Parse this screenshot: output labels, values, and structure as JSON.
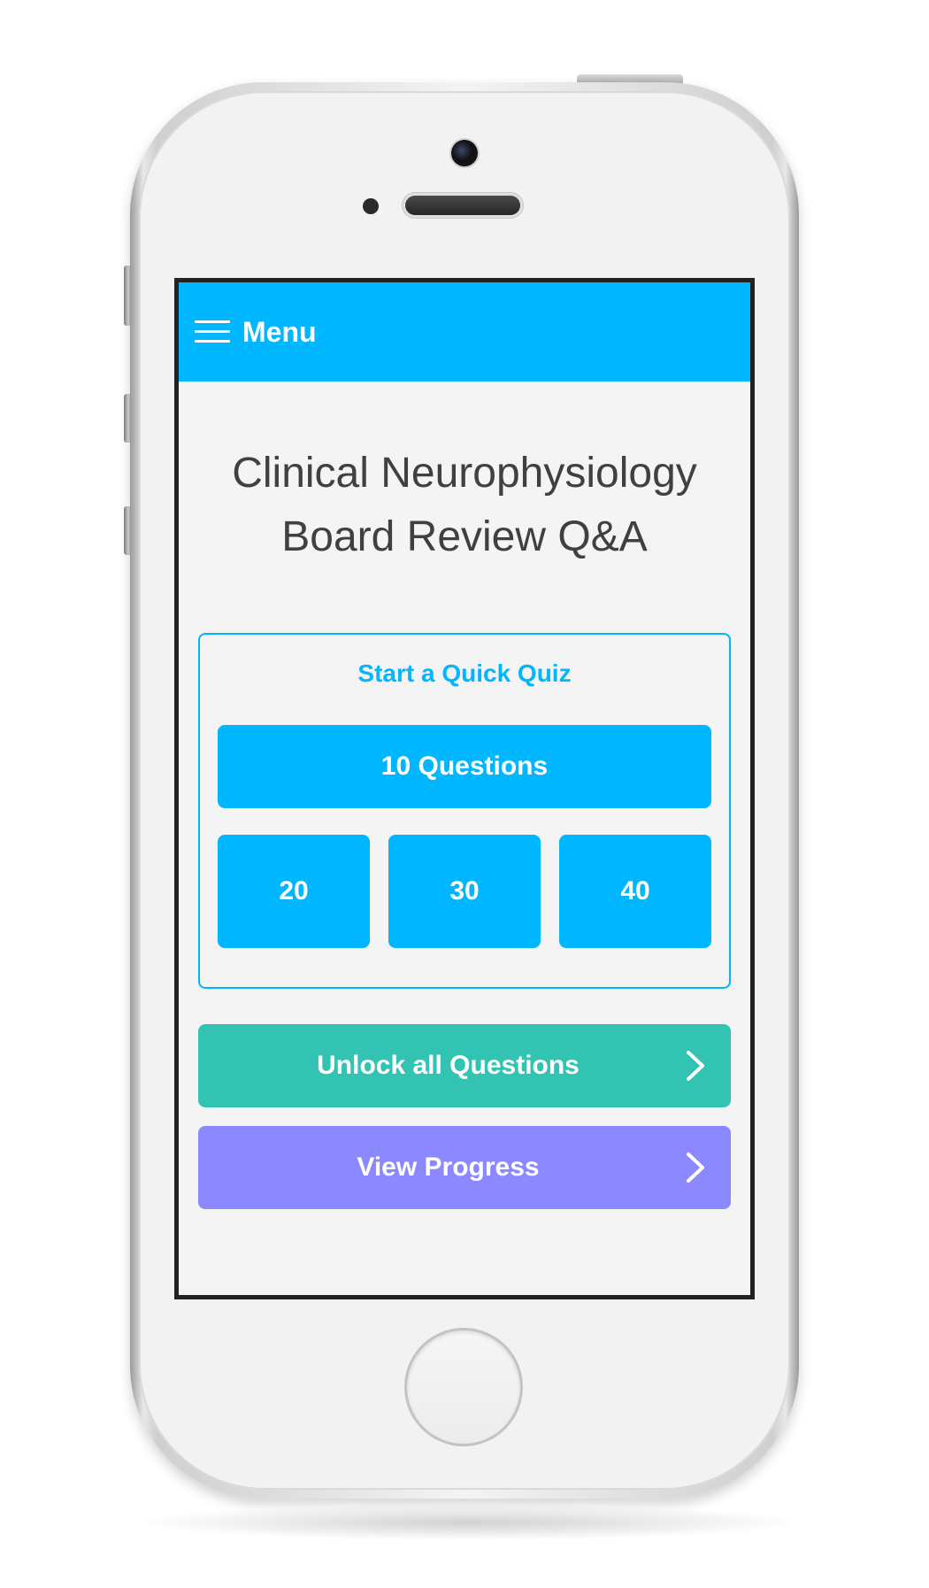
{
  "colors": {
    "accent": "#00b6ff",
    "unlock": "#33c3b2",
    "progress": "#8c88ff",
    "title_text": "#404040"
  },
  "header": {
    "menu_icon": "hamburger-menu-icon",
    "menu_label": "Menu"
  },
  "main": {
    "title_line1": "Clinical Neurophysiology",
    "title_line2": "Board Review Q&A",
    "quick_quiz": {
      "heading": "Start a Quick Quiz",
      "primary_option": "10 Questions",
      "options": [
        "20",
        "30",
        "40"
      ]
    },
    "unlock": {
      "label": "Unlock all Questions",
      "icon": "chevron-right-icon"
    },
    "progress": {
      "label": "View Progress",
      "icon": "chevron-right-icon"
    }
  }
}
